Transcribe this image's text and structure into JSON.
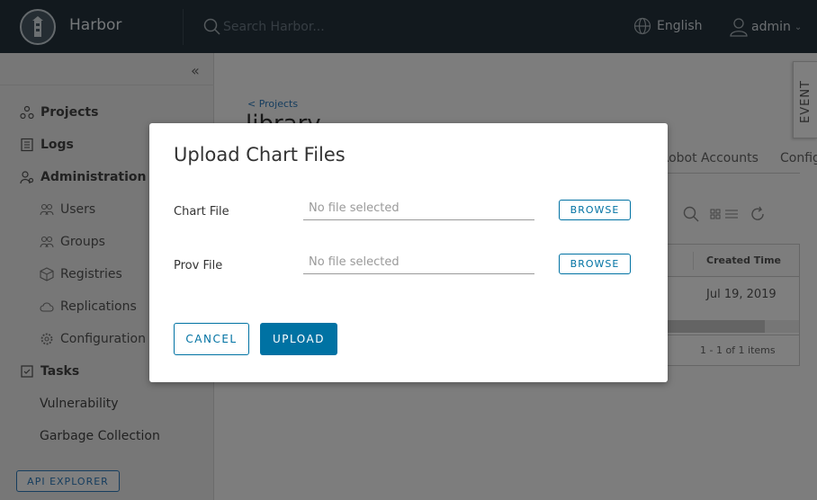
{
  "header": {
    "brand": "Harbor",
    "search_placeholder": "Search Harbor...",
    "language": "English",
    "user": "admin"
  },
  "sidebar": {
    "items": [
      {
        "label": "Projects"
      },
      {
        "label": "Logs"
      },
      {
        "label": "Administration"
      },
      {
        "label": "Users"
      },
      {
        "label": "Groups"
      },
      {
        "label": "Registries"
      },
      {
        "label": "Replications"
      },
      {
        "label": "Configuration"
      },
      {
        "label": "Tasks"
      },
      {
        "label": "Vulnerability"
      },
      {
        "label": "Garbage Collection"
      }
    ],
    "api_explorer": "API EXPLORER"
  },
  "main": {
    "breadcrumb": "< Projects",
    "project_name": "library",
    "tabs": [
      "Robot Accounts",
      "Configu"
    ],
    "grid": {
      "column": "Created Time",
      "row_value": "Jul 19, 2019",
      "footer": "1 - 1 of 1 items"
    }
  },
  "event_tab": "EVENT",
  "modal": {
    "title": "Upload Chart Files",
    "chart_label": "Chart File",
    "prov_label": "Prov File",
    "no_file": "No file selected",
    "browse": "BROWSE",
    "cancel": "CANCEL",
    "upload": "UPLOAD"
  },
  "colors": {
    "header_bg": "#25333d",
    "accent": "#0072a3"
  }
}
